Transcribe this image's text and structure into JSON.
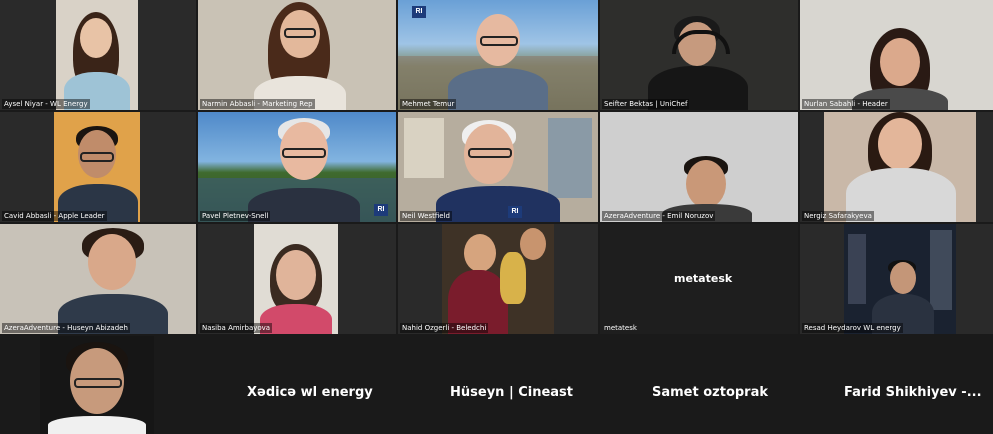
{
  "participants": [
    {
      "name": "Aysel Niyar - WL Energy"
    },
    {
      "name": "Narmin Abbasli - Marketing Rep"
    },
    {
      "name": "Mehmet Temur"
    },
    {
      "name": "Seifter Bektas | UniChef"
    },
    {
      "name": "Nurlan Sabahli - Header"
    },
    {
      "name": "Cavid Abbasli - Apple Leader"
    },
    {
      "name": "Pavel Pletnev-Snell"
    },
    {
      "name": "Neil Westfield"
    },
    {
      "name": "AzeraAdventure - Emil Noruzov"
    },
    {
      "name": "Nergiz Safarakyeva"
    },
    {
      "name": "AzeraAdventure - Huseyn Abizadeh"
    },
    {
      "name": "Nasiba Amirbayova"
    },
    {
      "name": "Nahid Ozgerli - Beledchi"
    },
    {
      "name": "metatesk"
    },
    {
      "name": "Resad Heydarov WL energy"
    }
  ],
  "metatesk_label": "metatesk",
  "logo_text": "RI",
  "bottom_names": [
    {
      "name": "Xədicə wl energy"
    },
    {
      "name": "Hüseyn | Cineast"
    },
    {
      "name": "Samet oztoprak"
    },
    {
      "name": "Farid  Shikhiyev  -..."
    }
  ]
}
